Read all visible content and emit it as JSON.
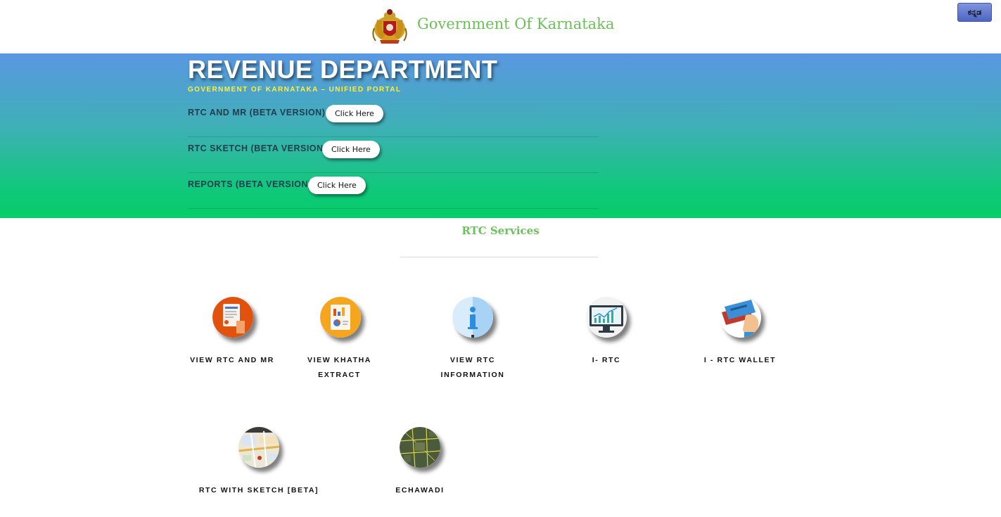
{
  "header": {
    "title": "Government Of Karnataka",
    "language_button": "ಕನ್ನಡ",
    "emblem_icon": "karnataka-emblem-icon"
  },
  "banner": {
    "title": "REVENUE DEPARTMENT",
    "subtitle": "GOVERNMENT OF KARNATAKA – UNIFIED PORTAL",
    "links": [
      {
        "label": "RTC AND MR (BETA VERSION)",
        "button": "Click Here"
      },
      {
        "label": "RTC SKETCH (BETA VERSION)",
        "button": "Click Here"
      },
      {
        "label": "REPORTS (BETA VERSION)",
        "button": "Click Here"
      }
    ]
  },
  "services": {
    "title": "RTC Services",
    "items": [
      {
        "label": "VIEW RTC AND MR",
        "icon": "document-icon"
      },
      {
        "label": "VIEW KHATHA EXTRACT",
        "icon": "report-chart-icon"
      },
      {
        "label": "VIEW RTC INFORMATION",
        "icon": "info-icon"
      },
      {
        "label": "I- RTC",
        "icon": "monitor-chart-icon"
      },
      {
        "label": "I - RTC WALLET",
        "icon": "wallet-card-icon"
      },
      {
        "label": "RTC WITH SKETCH [BETA]",
        "icon": "map-icon"
      },
      {
        "label": "ECHAWADI",
        "icon": "cadastral-map-icon"
      }
    ]
  },
  "colors": {
    "green_text": "#6cc05a",
    "banner_top": "#5a97e2",
    "banner_bottom": "#05cc68",
    "subtitle_yellow": "#ffef3a"
  }
}
